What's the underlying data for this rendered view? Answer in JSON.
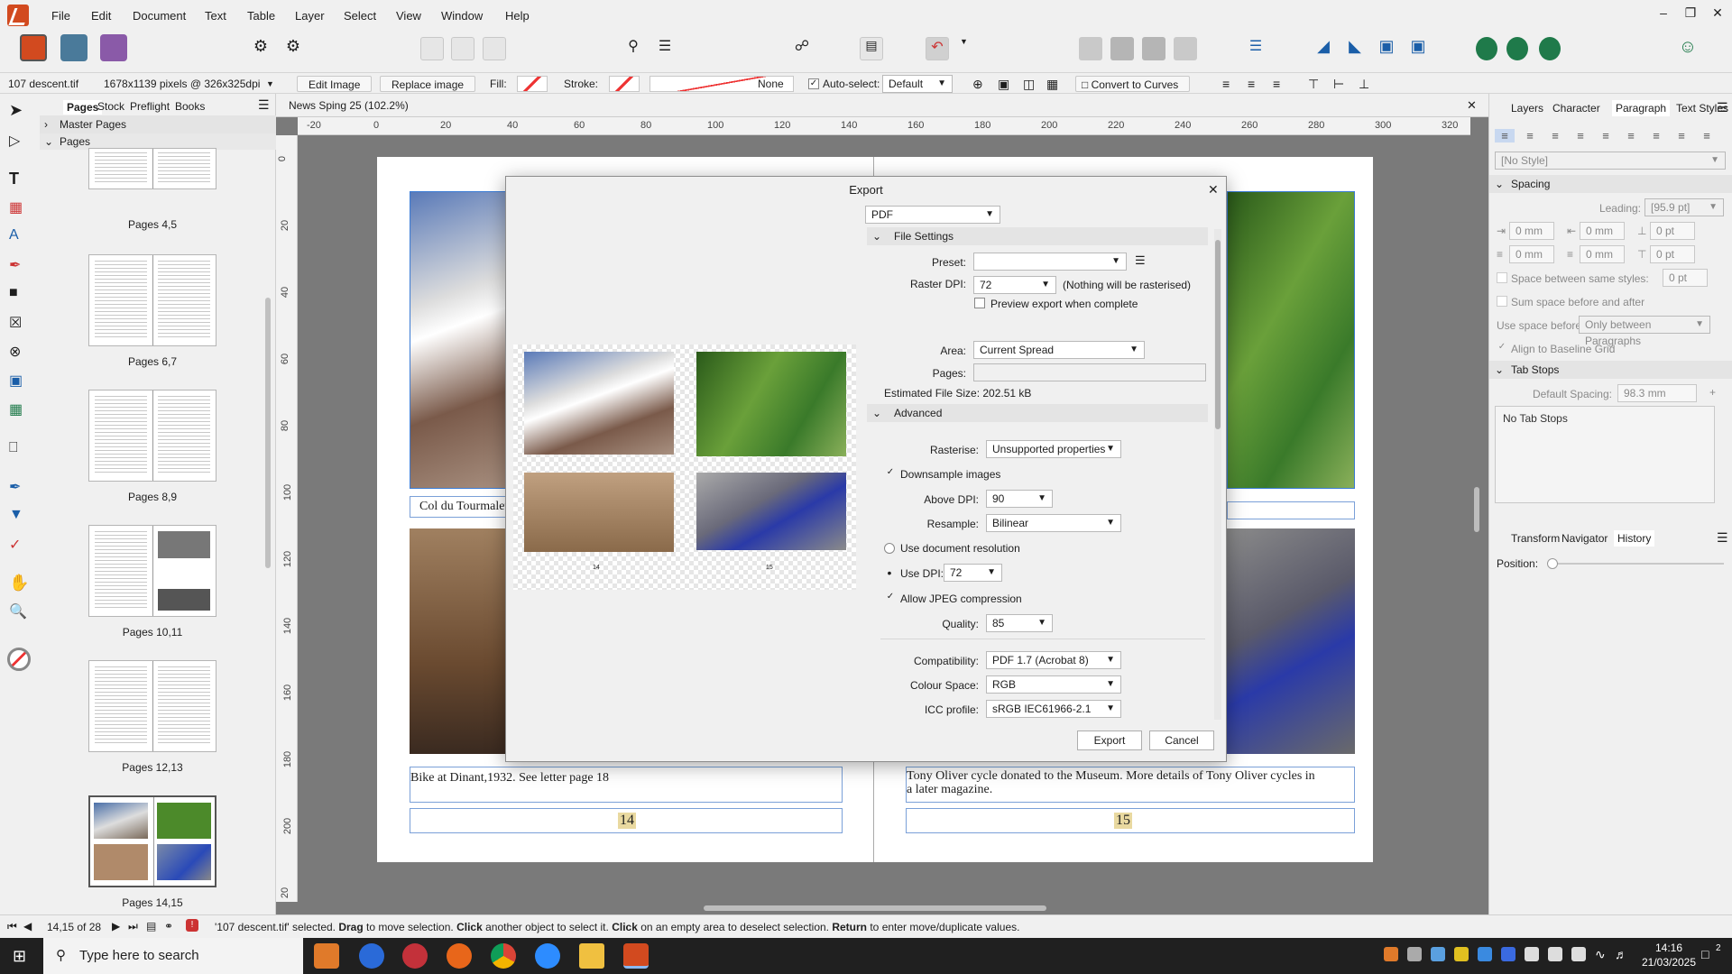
{
  "menubar": {
    "items": [
      "File",
      "Edit",
      "Document",
      "Text",
      "Table",
      "Layer",
      "Select",
      "View",
      "Window",
      "Help"
    ]
  },
  "context": {
    "file_name": "107 descent.tif",
    "pixel_info": "1678x1139 pixels @ 326x325dpi",
    "edit_image": "Edit Image",
    "replace_image": "Replace image",
    "fill_label": "Fill:",
    "stroke_label": "Stroke:",
    "stroke_none": "None",
    "auto_select_label": "Auto-select:",
    "auto_select_value": "Default",
    "convert_to_curves": "Convert to Curves"
  },
  "pages_panel": {
    "tabs": [
      "Pages",
      "Stock",
      "Preflight",
      "Books"
    ],
    "master_pages": "Master Pages",
    "pages": "Pages",
    "thumbnails": [
      "Pages 4,5",
      "Pages 6,7",
      "Pages 8,9",
      "Pages 10,11",
      "Pages 12,13",
      "Pages 14,15"
    ]
  },
  "document": {
    "tab_title": "News Sping 25 (102.2%)",
    "hruler": [
      "-20",
      "0",
      "20",
      "40",
      "60",
      "80",
      "100",
      "120",
      "140",
      "160",
      "180",
      "200",
      "220",
      "240",
      "260",
      "280",
      "300",
      "320"
    ],
    "vruler": [
      "0",
      "20",
      "40",
      "60",
      "80",
      "100",
      "120",
      "140",
      "160",
      "180",
      "200",
      "20"
    ],
    "caption_left_top": "Col du Tourmalet",
    "caption_left_bottom": "Bike at Dinant,1932. See letter page  18",
    "caption_right_bottom": "Tony Oliver cycle donated to the Museum. More details of Tony Oliver cycles in a later magazine.",
    "page_num_left": "14",
    "page_num_right": "15",
    "preview_page_left": "14",
    "preview_page_right": "15"
  },
  "export_dialog": {
    "title": "Export",
    "format": "PDF",
    "file_settings": "File Settings",
    "preset_label": "Preset:",
    "raster_dpi_label": "Raster DPI:",
    "raster_dpi_value": "72",
    "raster_note": "(Nothing will be rasterised)",
    "preview_export": "Preview export when complete",
    "area_label": "Area:",
    "area_value": "Current Spread",
    "pages_label": "Pages:",
    "estimated_size": "Estimated File Size: 202.51 kB",
    "advanced": "Advanced",
    "rasterise_label": "Rasterise:",
    "rasterise_value": "Unsupported properties",
    "downsample": "Downsample images",
    "above_dpi_label": "Above DPI:",
    "above_dpi_value": "90",
    "resample_label": "Resample:",
    "resample_value": "Bilinear",
    "use_doc_res": "Use document resolution",
    "use_dpi_label": "Use DPI:",
    "use_dpi_value": "72",
    "allow_jpeg": "Allow JPEG compression",
    "quality_label": "Quality:",
    "quality_value": "85",
    "compat_label": "Compatibility:",
    "compat_value": "PDF 1.7 (Acrobat 8)",
    "colour_space_label": "Colour Space:",
    "colour_space_value": "RGB",
    "icc_label": "ICC profile:",
    "icc_value": "sRGB IEC61966-2.1",
    "export_button": "Export",
    "cancel_button": "Cancel"
  },
  "right_panel": {
    "tabs": [
      "Layers",
      "Character",
      "Paragraph",
      "Text Styles"
    ],
    "style_value": "[No Style]",
    "spacing": "Spacing",
    "leading_label": "Leading:",
    "leading_value": "[95.9 pt]",
    "mm0": "0 mm",
    "pt0": "0 pt",
    "space_between": "Space between same styles:",
    "sum_space": "Sum space before and after",
    "use_space_before": "Use space before:",
    "use_space_value": "Only between Paragraphs",
    "align_baseline": "Align to Baseline Grid",
    "tab_stops": "Tab Stops",
    "default_spacing_label": "Default Spacing:",
    "default_spacing_value": "98.3 mm",
    "no_tab_stops": "No Tab Stops",
    "bottom_tabs": [
      "Transform",
      "Navigator",
      "History"
    ],
    "position_label": "Position:"
  },
  "statusbar": {
    "page_info": "14,15 of 28",
    "message_pre": "'107 descent.tif' selected. ",
    "b1": "Drag",
    "t1": " to move selection. ",
    "b2": "Click",
    "t2": " another object to select it. ",
    "b3": "Click",
    "t3": " on an empty area to deselect selection. ",
    "b4": "Return",
    "t4": " to enter move/duplicate values."
  },
  "taskbar": {
    "search_placeholder": "Type here to search",
    "time": "14:16",
    "date": "21/03/2025",
    "notification_count": "2"
  },
  "colors": {
    "accent": "#3a7bd5",
    "affinity_orange": "#d24a1f",
    "taskbar": "#202020"
  }
}
